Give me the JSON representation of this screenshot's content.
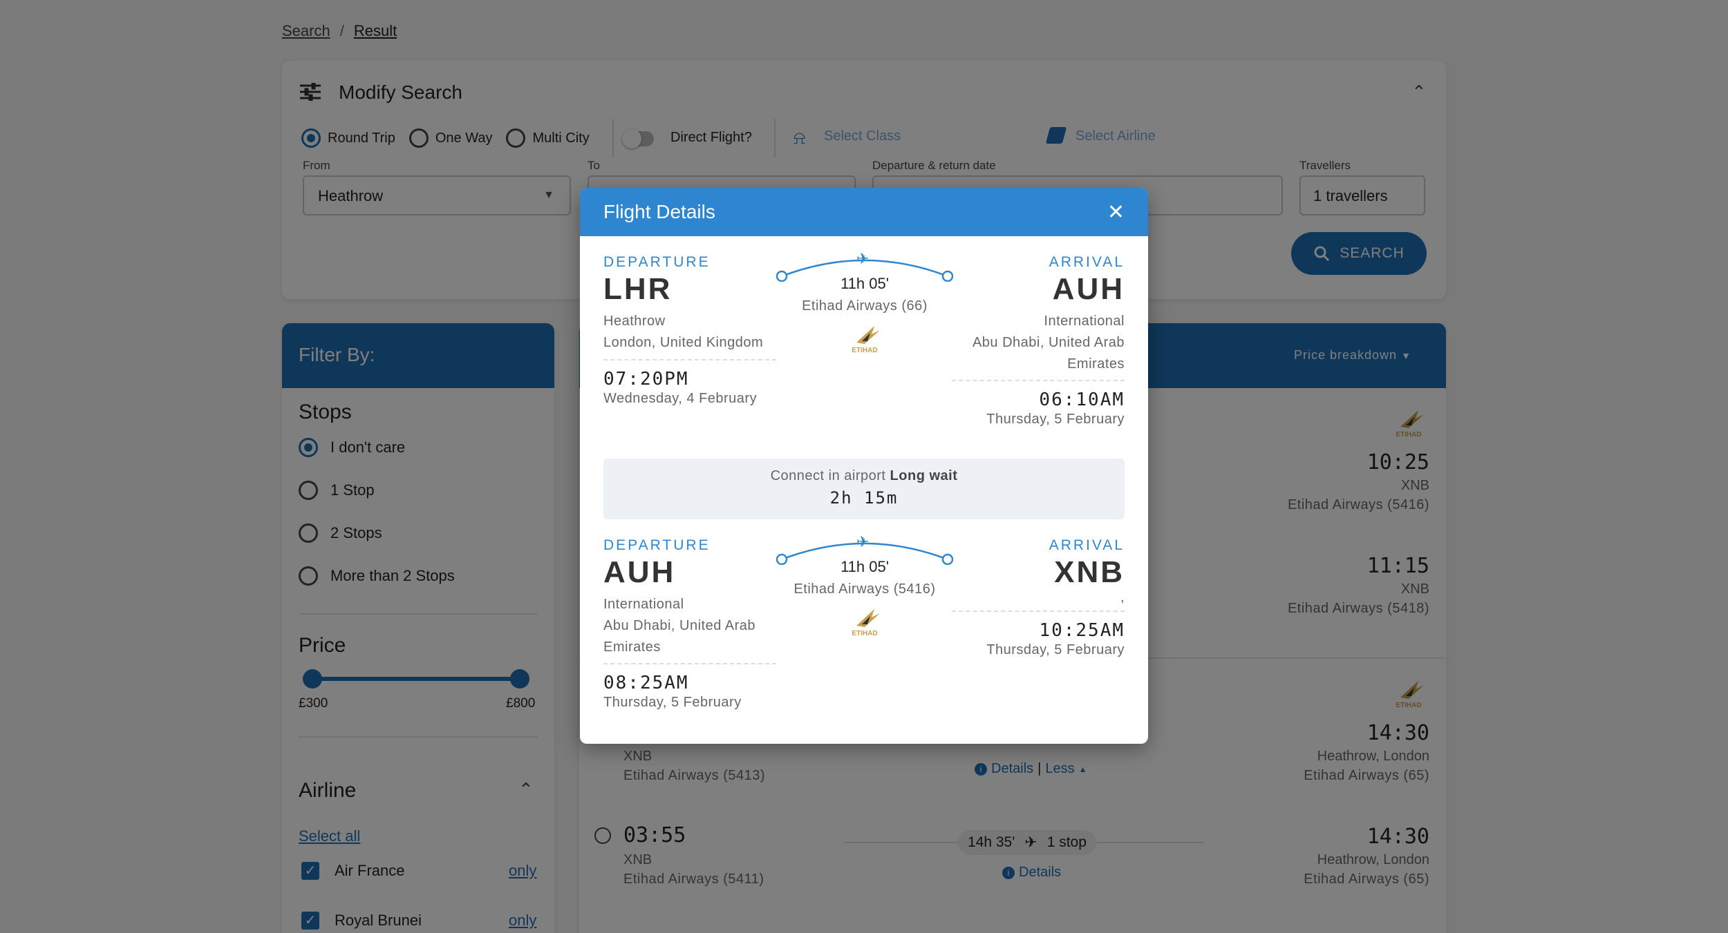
{
  "breadcrumb": {
    "search": "Search",
    "sep": "/",
    "result": "Result"
  },
  "modify": {
    "title": "Modify Search",
    "trip_types": [
      "Round Trip",
      "One Way",
      "Multi City"
    ],
    "direct_flight": "Direct Flight?",
    "select_class": "Select Class",
    "select_airline": "Select Airline",
    "from_label": "From",
    "from_value": "Heathrow",
    "to_label": "To",
    "dates_label": "Departure & return date",
    "travellers_label": "Travellers",
    "travellers_value": "1 travellers",
    "search_button": "SEARCH"
  },
  "filters": {
    "header": "Filter By:",
    "stops_title": "Stops",
    "stops": [
      "I don't care",
      "1 Stop",
      "2 Stops",
      "More than 2 Stops"
    ],
    "price_title": "Price",
    "price_min": "£300",
    "price_max": "£800",
    "price_range_fraction": [
      0.0,
      1.0
    ],
    "airline_title": "Airline",
    "select_all": "Select all",
    "airlines": [
      {
        "name": "Air France",
        "only": "only"
      },
      {
        "name": "Royal Brunei",
        "only": "only"
      }
    ]
  },
  "results": {
    "price_breakdown": "Price breakdown",
    "right_column": [
      {
        "time": "10:25",
        "place": "XNB",
        "airline": "Etihad Airways (5416)"
      },
      {
        "time": "11:15",
        "place": "XNB",
        "airline": "Etihad Airways (5418)"
      },
      {
        "time": "14:30",
        "place": "Heathrow, London",
        "airline": "Etihad Airways (65)"
      },
      {
        "time": "14:30",
        "place": "Heathrow, London",
        "airline": "Etihad Airways (65)"
      }
    ],
    "left_rows": [
      {
        "place": "XNB",
        "airline": "Etihad Airways (5413)"
      },
      {
        "time": "03:55",
        "place": "XNB",
        "airline": "Etihad Airways (5411)"
      }
    ],
    "mid_details": "Details",
    "mid_less": "Less",
    "mid_sep": "|",
    "duration_pill": "14h 35'",
    "stops_pill": "1 stop"
  },
  "modal": {
    "title": "Flight Details",
    "segments": [
      {
        "dep_label": "DEPARTURE",
        "dep_code": "LHR",
        "dep_airport": "Heathrow",
        "dep_city": "London, United Kingdom",
        "dep_time": "07:20PM",
        "dep_date": "Wednesday, 4 February",
        "duration": "11h 05'",
        "airline": "Etihad Airways (66)",
        "arr_label": "ARRIVAL",
        "arr_code": "AUH",
        "arr_airport": "International",
        "arr_city": "Abu Dhabi, United Arab Emirates",
        "arr_time": "06:10AM",
        "arr_date": "Thursday, 5 February"
      },
      {
        "dep_label": "DEPARTURE",
        "dep_code": "AUH",
        "dep_airport": "International",
        "dep_city": "Abu Dhabi, United Arab Emirates",
        "dep_time": "08:25AM",
        "dep_date": "Thursday, 5 February",
        "duration": "11h 05'",
        "airline": "Etihad Airways (5416)",
        "arr_label": "ARRIVAL",
        "arr_code": "XNB",
        "arr_airport": ",",
        "arr_city": "",
        "arr_time": "10:25AM",
        "arr_date": "Thursday, 5 February"
      }
    ],
    "connect_text": "Connect in airport",
    "connect_strong": "Long wait",
    "connect_duration": "2h 15m",
    "logo_text": "ETIHAD"
  }
}
